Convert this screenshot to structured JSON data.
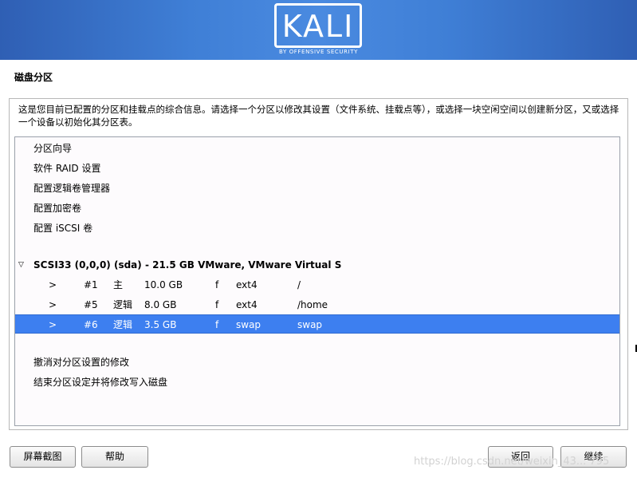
{
  "header": {
    "logo_text": "KALI",
    "logo_sub": "BY OFFENSIVE SECURITY"
  },
  "step_title": "磁盘分区",
  "intro_text": "这是您目前已配置的分区和挂载点的综合信息。请选择一个分区以修改其设置（文件系统、挂载点等），或选择一块空闲空间以创建新分区，又或选择一个设备以初始化其分区表。",
  "options": {
    "guided": "分区向导",
    "software_raid": "软件 RAID 设置",
    "lvm": "配置逻辑卷管理器",
    "encrypted": "配置加密卷",
    "iscsi": "配置 iSCSI 卷"
  },
  "disk": {
    "label": "SCSI33 (0,0,0) (sda) - 21.5 GB VMware, VMware Virtual S",
    "partitions": [
      {
        "arrow": ">",
        "num": "#1",
        "type": "主",
        "size": "10.0 GB",
        "flag": "f",
        "fs": "ext4",
        "mount": "/"
      },
      {
        "arrow": ">",
        "num": "#5",
        "type": "逻辑",
        "size": "8.0 GB",
        "flag": "f",
        "fs": "ext4",
        "mount": "/home"
      },
      {
        "arrow": ">",
        "num": "#6",
        "type": "逻辑",
        "size": "3.5 GB",
        "flag": "f",
        "fs": "swap",
        "mount": "swap"
      }
    ]
  },
  "actions": {
    "undo": "撤消对分区设置的修改",
    "finish": "结束分区设定并将修改写入磁盘"
  },
  "buttons": {
    "screenshot": "屏幕截图",
    "help": "帮助",
    "back": "返回",
    "continue": "继续"
  },
  "watermark": "https://blog.csdn.net/weixin_43... 795",
  "colors": {
    "banner": "#3f7fd6",
    "selection": "#3d7ff0"
  }
}
